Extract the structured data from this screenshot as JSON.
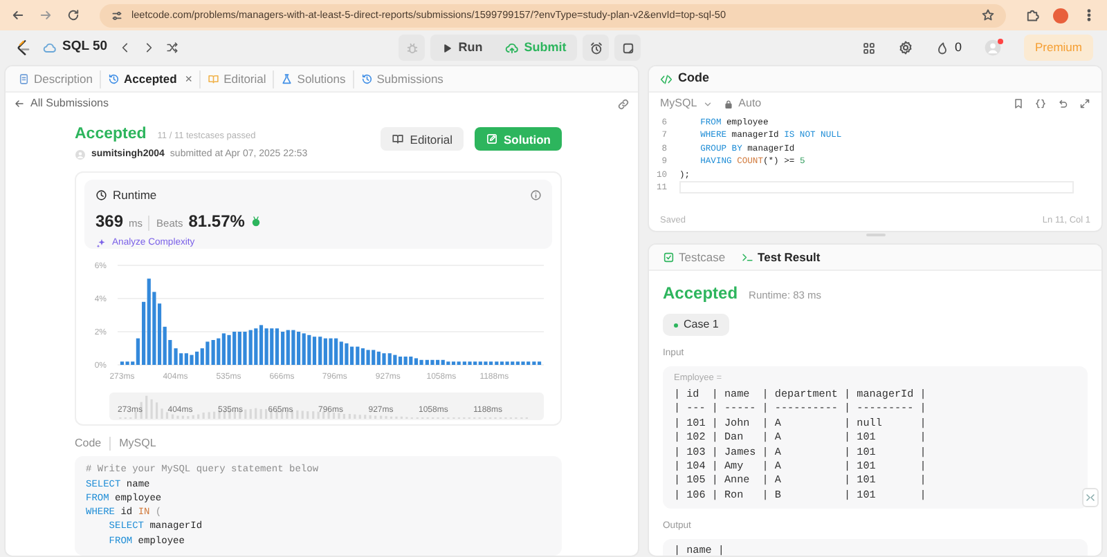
{
  "browser": {
    "url": "leetcode.com/problems/managers-with-at-least-5-direct-reports/submissions/1599799157/?envType=study-plan-v2&envId=top-sql-50"
  },
  "toolbar": {
    "study_plan": "SQL 50",
    "run": "Run",
    "submit": "Submit",
    "streak": "0",
    "premium": "Premium"
  },
  "left": {
    "tabs": [
      {
        "label": "Description",
        "selected": false
      },
      {
        "label": "Accepted",
        "selected": true,
        "close": "×"
      },
      {
        "label": "Editorial",
        "selected": false
      },
      {
        "label": "Solutions",
        "selected": false
      },
      {
        "label": "Submissions",
        "selected": false
      }
    ],
    "back_link": "All Submissions",
    "submission": {
      "status": "Accepted",
      "testcases": "11 / 11 testcases passed",
      "user": "sumitsingh2004",
      "submitted": "submitted at Apr 07, 2025 22:53"
    },
    "buttons": {
      "editorial": "Editorial",
      "solution": "Solution"
    },
    "runtime": {
      "title": "Runtime",
      "value": "369",
      "unit": "ms",
      "beats_label": "Beats",
      "beats": "81.57%",
      "analyze": "Analyze Complexity",
      "chart_data": {
        "type": "bar",
        "xlim": [
          262,
          1310
        ],
        "ylim": [
          0,
          6
        ],
        "yticks": [
          {
            "value": 0,
            "label": "0%"
          },
          {
            "value": 2,
            "label": "2%"
          },
          {
            "value": 4,
            "label": "4%"
          },
          {
            "value": 6,
            "label": "6%"
          }
        ],
        "xticks": [
          {
            "value": 273,
            "label": "273ms"
          },
          {
            "value": 404,
            "label": "404ms"
          },
          {
            "value": 535,
            "label": "535ms"
          },
          {
            "value": 666,
            "label": "666ms"
          },
          {
            "value": 796,
            "label": "796ms"
          },
          {
            "value": 927,
            "label": "927ms"
          },
          {
            "value": 1058,
            "label": "1058ms"
          },
          {
            "value": 1188,
            "label": "1188ms"
          }
        ],
        "x": [
          273,
          286,
          299,
          312,
          326,
          339,
          352,
          365,
          378,
          391,
          405,
          418,
          431,
          444,
          457,
          470,
          483,
          497,
          510,
          523,
          536,
          549,
          562,
          575,
          589,
          602,
          615,
          628,
          641,
          654,
          668,
          681,
          694,
          707,
          720,
          733,
          746,
          760,
          773,
          786,
          799,
          812,
          825,
          838,
          852,
          865,
          878,
          891,
          904,
          917,
          931,
          944,
          957,
          970,
          983,
          996,
          1009,
          1023,
          1036,
          1049,
          1062,
          1075,
          1088,
          1101,
          1115,
          1128,
          1141,
          1154,
          1167,
          1180,
          1194,
          1207,
          1220,
          1233,
          1246,
          1259,
          1272,
          1286,
          1299
        ],
        "series": [
          {
            "color": "#3389db",
            "values": [
              0.2,
              0.2,
              0.2,
              1.6,
              3.8,
              5.2,
              4.4,
              3.7,
              2.3,
              1.5,
              1.0,
              0.7,
              0.7,
              0.6,
              0.8,
              1.0,
              1.4,
              1.5,
              1.6,
              1.9,
              1.8,
              2.0,
              2.0,
              2.0,
              2.1,
              2.2,
              2.4,
              2.2,
              2.2,
              2.2,
              2.0,
              2.1,
              2.1,
              2.0,
              1.9,
              1.8,
              1.7,
              1.7,
              1.6,
              1.6,
              1.6,
              1.4,
              1.3,
              1.1,
              1.1,
              1.0,
              0.9,
              0.9,
              0.8,
              0.7,
              0.7,
              0.6,
              0.5,
              0.5,
              0.5,
              0.4,
              0.3,
              0.3,
              0.3,
              0.3,
              0.3,
              0.2,
              0.2,
              0.2,
              0.2,
              0.2,
              0.2,
              0.2,
              0.2,
              0.2,
              0.2,
              0.2,
              0.2,
              0.2,
              0.2,
              0.2,
              0.2,
              0.2,
              0.2
            ]
          }
        ],
        "stacked": false
      },
      "overview_labels": [
        "273ms",
        "404ms",
        "535ms",
        "665ms",
        "796ms",
        "927ms",
        "1058ms",
        "1188ms"
      ]
    },
    "code": {
      "label": "Code",
      "language": "MySQL",
      "lines": [
        {
          "tokens": [
            {
              "text": "# Write your MySQL query statement below",
              "kind": "comment"
            }
          ]
        },
        {
          "tokens": [
            {
              "text": "SELECT",
              "kind": "keyword"
            },
            {
              "text": " name",
              "kind": "plain"
            }
          ]
        },
        {
          "tokens": [
            {
              "text": "FROM",
              "kind": "keyword"
            },
            {
              "text": " employee",
              "kind": "plain"
            }
          ]
        },
        {
          "tokens": [
            {
              "text": "WHERE",
              "kind": "keyword"
            },
            {
              "text": " id ",
              "kind": "plain"
            },
            {
              "text": "IN",
              "kind": "operator"
            },
            {
              "text": " (",
              "kind": "punct"
            }
          ]
        },
        {
          "tokens": [
            {
              "text": "    SELECT",
              "kind": "keyword"
            },
            {
              "text": " managerId",
              "kind": "plain"
            }
          ]
        },
        {
          "tokens": [
            {
              "text": "    FROM",
              "kind": "keyword"
            },
            {
              "text": " employee",
              "kind": "plain"
            }
          ]
        }
      ]
    }
  },
  "editor": {
    "title": "Code",
    "language": "MySQL",
    "mode": "Auto",
    "lines": [
      {
        "number": "6",
        "active": false,
        "tokens": [
          {
            "text": "    FROM",
            "kind": "keyword"
          },
          {
            "text": " employee",
            "kind": "plain"
          }
        ]
      },
      {
        "number": "7",
        "active": false,
        "tokens": [
          {
            "text": "    WHERE",
            "kind": "keyword"
          },
          {
            "text": " managerId ",
            "kind": "plain"
          },
          {
            "text": "IS NOT NULL",
            "kind": "keyword"
          }
        ]
      },
      {
        "number": "8",
        "active": false,
        "tokens": [
          {
            "text": "    GROUP BY",
            "kind": "keyword"
          },
          {
            "text": " managerId",
            "kind": "plain"
          }
        ]
      },
      {
        "number": "9",
        "active": false,
        "tokens": [
          {
            "text": "    HAVING ",
            "kind": "keyword"
          },
          {
            "text": "COUNT",
            "kind": "function"
          },
          {
            "text": "(*) >= ",
            "kind": "plain"
          },
          {
            "text": "5",
            "kind": "number"
          }
        ]
      },
      {
        "number": "10",
        "active": false,
        "tokens": [
          {
            "text": ");",
            "kind": "plain"
          }
        ]
      },
      {
        "number": "11",
        "active": true
      }
    ],
    "status": "Saved",
    "cursor": "Ln 11, Col 1"
  },
  "result": {
    "tabs": [
      {
        "label": "Testcase",
        "selected": false
      },
      {
        "label": "Test Result",
        "selected": true
      }
    ],
    "status": "Accepted",
    "runtime": "Runtime: 83 ms",
    "cases": [
      {
        "label": "Case 1",
        "selected": true,
        "passed": true
      }
    ],
    "input_label": "Input",
    "input_name": "Employee =",
    "input_lines": [
      "| id  | name  | department | managerId |",
      "| --- | ----- | ---------- | --------- |",
      "| 101 | John  | A          | null      |",
      "| 102 | Dan   | A          | 101       |",
      "| 103 | James | A          | 101       |",
      "| 104 | Amy   | A          | 101       |",
      "| 105 | Anne  | A          | 101       |",
      "| 106 | Ron   | B          | 101       |"
    ],
    "output_label": "Output",
    "output_lines": [
      "| name |"
    ]
  }
}
